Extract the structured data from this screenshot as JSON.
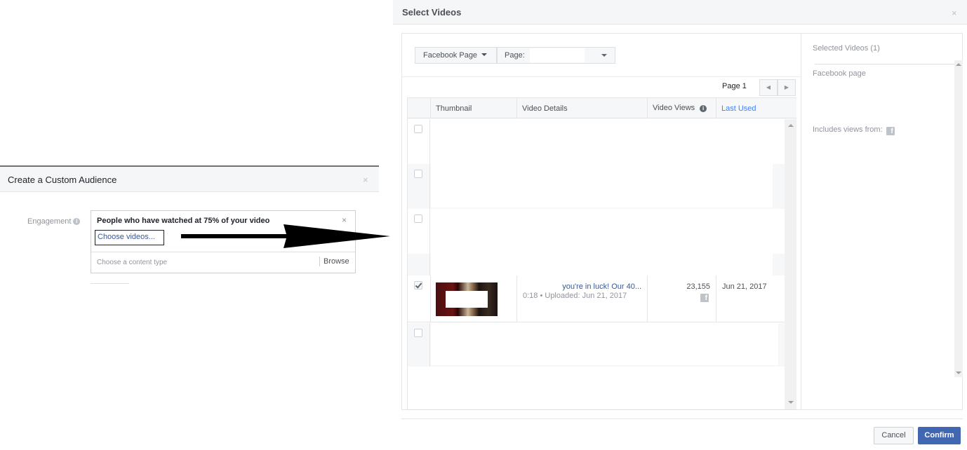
{
  "custom_audience": {
    "title": "Create a Custom Audience",
    "close_icon": "×",
    "engagement_label": "Engagement",
    "info_icon": "i",
    "rule_title": "People who have watched at 75% of your video",
    "rule_remove_icon": "×",
    "choose_videos_link": "Choose videos...",
    "content_type_placeholder": "Choose a content type",
    "browse_button": "Browse"
  },
  "select_videos": {
    "title": "Select Videos",
    "close_icon": "×",
    "filter": {
      "source_button": "Facebook Page",
      "page_select_label": "Page:",
      "page_select_value": ""
    },
    "pager": {
      "label": "Page 1",
      "prev_icon": "◀",
      "next_icon": "▶"
    },
    "table": {
      "columns": [
        "Thumbnail",
        "Video Details",
        "Video Views",
        "Last Used"
      ],
      "info_icon": "i",
      "rows": [
        {
          "checked": false,
          "title": "",
          "meta": "",
          "views": "",
          "last_used": ""
        },
        {
          "checked": false,
          "title": "",
          "meta": "",
          "views": "",
          "last_used": ""
        },
        {
          "checked": false,
          "title": "",
          "meta": "",
          "views": "",
          "last_used": ""
        },
        {
          "checked": false,
          "title": "",
          "meta": "",
          "views": "",
          "last_used": ""
        },
        {
          "checked": true,
          "title": "you're in luck! Our 40...",
          "meta": "0:18 • Uploaded: Jun 21, 2017",
          "views": "23,155",
          "last_used": "Jun 21, 2017"
        },
        {
          "checked": false,
          "title": "",
          "meta": "",
          "views": "",
          "last_used": ""
        }
      ]
    },
    "selected_panel": {
      "title": "Selected Videos (1)",
      "page_name": "Facebook page",
      "includes_label": "Includes views from:",
      "facebook_icon": "f"
    },
    "footer": {
      "cancel_button": "Cancel",
      "confirm_button": "Confirm"
    }
  },
  "colors": {
    "brand_blue": "#4267b2",
    "link_blue": "#365899",
    "sort_link_blue": "#4080ff",
    "header_bg": "#f5f6f7"
  }
}
